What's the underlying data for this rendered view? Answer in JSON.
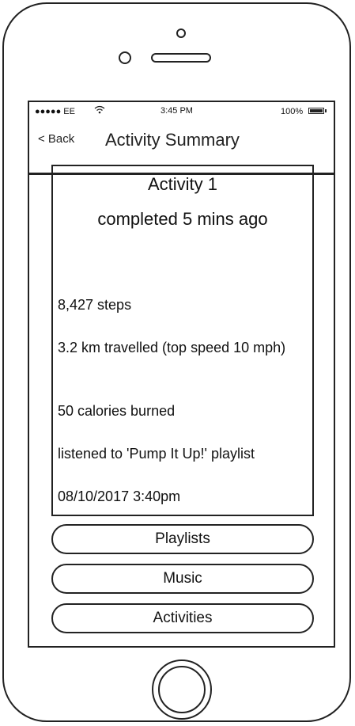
{
  "status_bar": {
    "carrier": "●●●●● EE",
    "wifi_icon": "wifi-icon",
    "time": "3:45 PM",
    "battery_percent": "100%",
    "battery_icon": "battery-icon"
  },
  "nav": {
    "back_label": "< Back",
    "title": "Activity Summary"
  },
  "activity": {
    "title": "Activity 1",
    "subtitle": "completed 5 mins ago",
    "steps": "8,427 steps",
    "distance": "3.2 km travelled (top speed 10 mph)",
    "calories": "50 calories burned",
    "playlist": "listened to 'Pump It Up!' playlist",
    "datetime": "08/10/2017 3:40pm"
  },
  "buttons": {
    "playlists": "Playlists",
    "music": "Music",
    "activities": "Activities"
  }
}
